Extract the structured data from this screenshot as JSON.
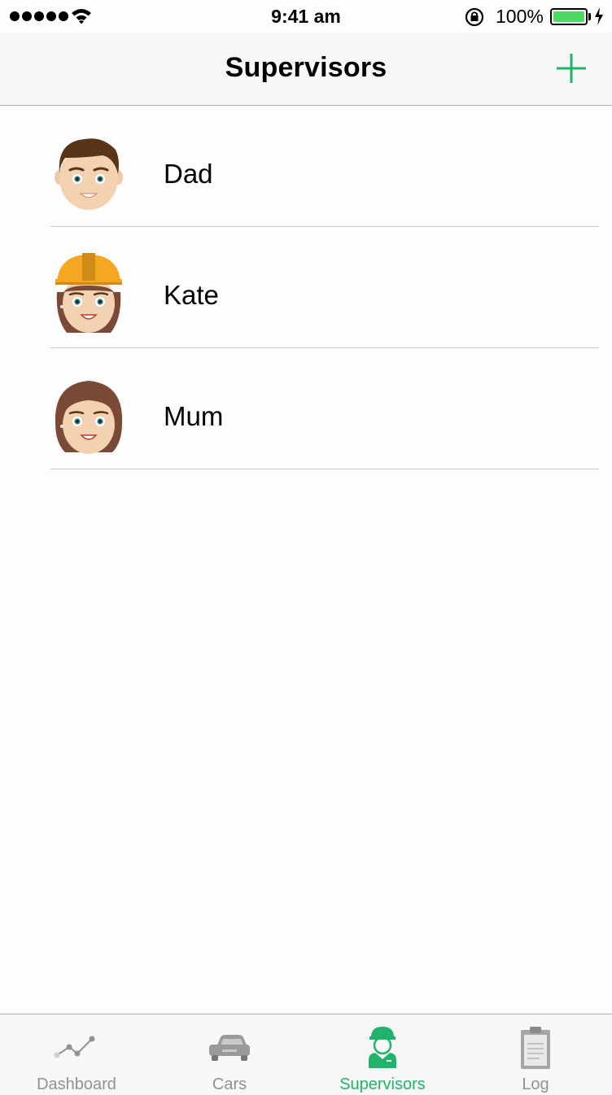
{
  "status_bar": {
    "time": "9:41 am",
    "battery_percent": "100%",
    "signal_bars": 5
  },
  "nav": {
    "title": "Supervisors",
    "add_icon": "plus-icon"
  },
  "supervisors": [
    {
      "name": "Dad",
      "avatar": "man-avatar-icon"
    },
    {
      "name": "Kate",
      "avatar": "woman-hardhat-avatar-icon"
    },
    {
      "name": "Mum",
      "avatar": "woman-avatar-icon"
    }
  ],
  "tabs": [
    {
      "label": "Dashboard",
      "icon": "chart-line-icon",
      "active": false
    },
    {
      "label": "Cars",
      "icon": "car-icon",
      "active": false
    },
    {
      "label": "Supervisors",
      "icon": "supervisor-icon",
      "active": true
    },
    {
      "label": "Log",
      "icon": "clipboard-icon",
      "active": false
    }
  ],
  "colors": {
    "accent": "#21b36c",
    "tab_inactive": "#929292",
    "battery": "#4cd964",
    "hardhat": "#f5a623"
  }
}
